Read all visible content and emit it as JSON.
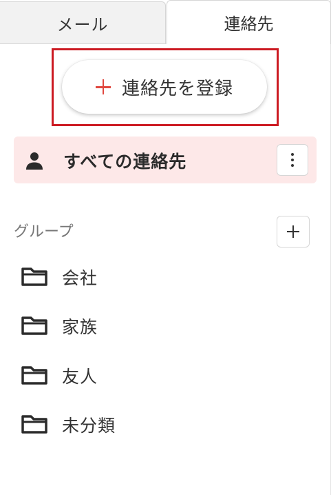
{
  "tabs": {
    "mail": "メール",
    "contacts": "連絡先",
    "active": "contacts"
  },
  "register": {
    "label": "連絡先を登録",
    "icon": "plus-icon",
    "accent": "#e0473f",
    "highlight_color": "#cc1a22"
  },
  "all_contacts": {
    "label": "すべての連絡先",
    "icon": "person-icon",
    "more_icon": "more-vertical-icon",
    "background": "#fde8e8"
  },
  "groups": {
    "heading": "グループ",
    "add_icon": "plus-icon",
    "items": [
      {
        "label": "会社",
        "icon": "folder-icon"
      },
      {
        "label": "家族",
        "icon": "folder-icon"
      },
      {
        "label": "友人",
        "icon": "folder-icon"
      },
      {
        "label": "未分類",
        "icon": "folder-icon"
      }
    ]
  }
}
